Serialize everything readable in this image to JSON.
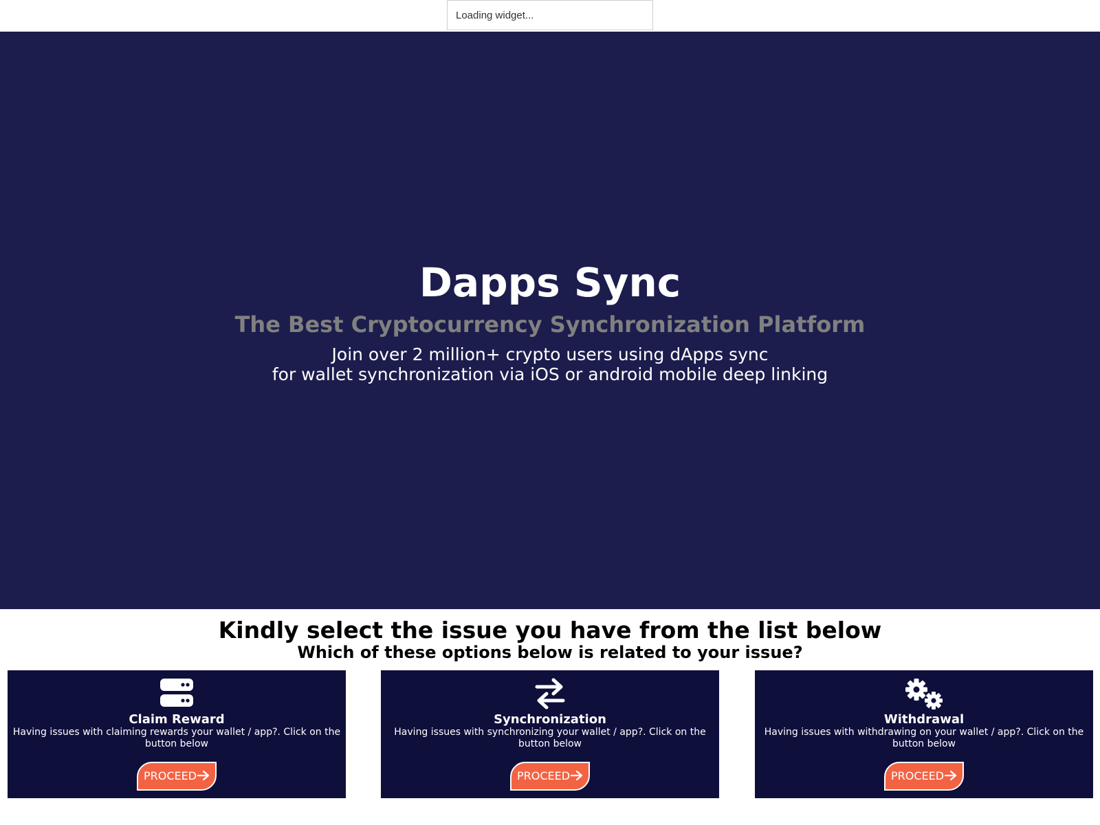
{
  "widget": {
    "text": "Loading widget..."
  },
  "hero": {
    "title": "Dapps Sync",
    "subtitle": "The Best Cryptocurrency Synchronization Platform",
    "line1": "Join over 2 million+ crypto users using dApps sync",
    "line2": "for wallet synchronization via iOS or android mobile deep linking"
  },
  "issues": {
    "title": "Kindly select the issue you have from the list below",
    "subtitle": "Which of these options below is related to your issue?",
    "cards": [
      {
        "icon": "server-icon",
        "title": "Claim Reward",
        "description": "Having issues with claiming rewards your wallet / app?. Click on the button below",
        "button": "PROCEED"
      },
      {
        "icon": "exchange-arrows-icon",
        "title": "Synchronization",
        "description": "Having issues with synchronizing your wallet / app?. Click on the button below",
        "button": "PROCEED"
      },
      {
        "icon": "gears-icon",
        "title": "Withdrawal",
        "description": "Having issues with withdrawing on your wallet / app?. Click on the button below",
        "button": "PROCEED"
      }
    ]
  },
  "colors": {
    "hero_bg": "#1c1d4d",
    "subtitle": "#808080",
    "card_bg": "#0f0f3c",
    "button_bg": "#f26344"
  }
}
